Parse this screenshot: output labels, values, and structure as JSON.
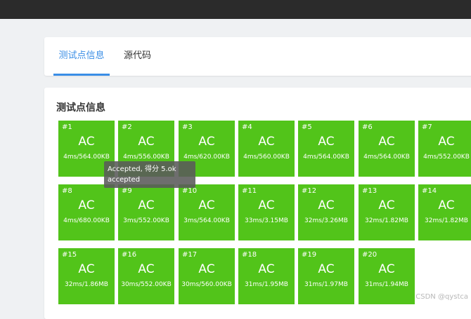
{
  "tabs": [
    {
      "label": "测试点信息",
      "active": true
    },
    {
      "label": "源代码",
      "active": false
    }
  ],
  "section_title": "测试点信息",
  "cases": [
    {
      "id": "#1",
      "result": "AC",
      "stat": "4ms/564.00KB"
    },
    {
      "id": "#2",
      "result": "AC",
      "stat": "4ms/556.00KB"
    },
    {
      "id": "#3",
      "result": "AC",
      "stat": "4ms/620.00KB"
    },
    {
      "id": "#4",
      "result": "AC",
      "stat": "4ms/560.00KB"
    },
    {
      "id": "#5",
      "result": "AC",
      "stat": "4ms/564.00KB"
    },
    {
      "id": "#6",
      "result": "AC",
      "stat": "4ms/564.00KB"
    },
    {
      "id": "#7",
      "result": "AC",
      "stat": "4ms/552.00KB"
    },
    {
      "id": "#8",
      "result": "AC",
      "stat": "4ms/680.00KB"
    },
    {
      "id": "#9",
      "result": "AC",
      "stat": "3ms/552.00KB"
    },
    {
      "id": "#10",
      "result": "AC",
      "stat": "3ms/564.00KB"
    },
    {
      "id": "#11",
      "result": "AC",
      "stat": "33ms/3.15MB"
    },
    {
      "id": "#12",
      "result": "AC",
      "stat": "32ms/3.26MB"
    },
    {
      "id": "#13",
      "result": "AC",
      "stat": "32ms/1.82MB"
    },
    {
      "id": "#14",
      "result": "AC",
      "stat": "32ms/1.82MB"
    },
    {
      "id": "#15",
      "result": "AC",
      "stat": "32ms/1.86MB"
    },
    {
      "id": "#16",
      "result": "AC",
      "stat": "30ms/552.00KB"
    },
    {
      "id": "#17",
      "result": "AC",
      "stat": "30ms/560.00KB"
    },
    {
      "id": "#18",
      "result": "AC",
      "stat": "31ms/1.95MB"
    },
    {
      "id": "#19",
      "result": "AC",
      "stat": "31ms/1.97MB"
    },
    {
      "id": "#20",
      "result": "AC",
      "stat": "31ms/1.94MB"
    }
  ],
  "tooltip": {
    "line1": "Accepted, 得分 5.ok",
    "line2": "accepted"
  },
  "watermark": "CSDN @qystca",
  "colors": {
    "accepted": "#52c41a",
    "tab_active": "#3a8ee6",
    "topbar": "#2b2b2b"
  }
}
